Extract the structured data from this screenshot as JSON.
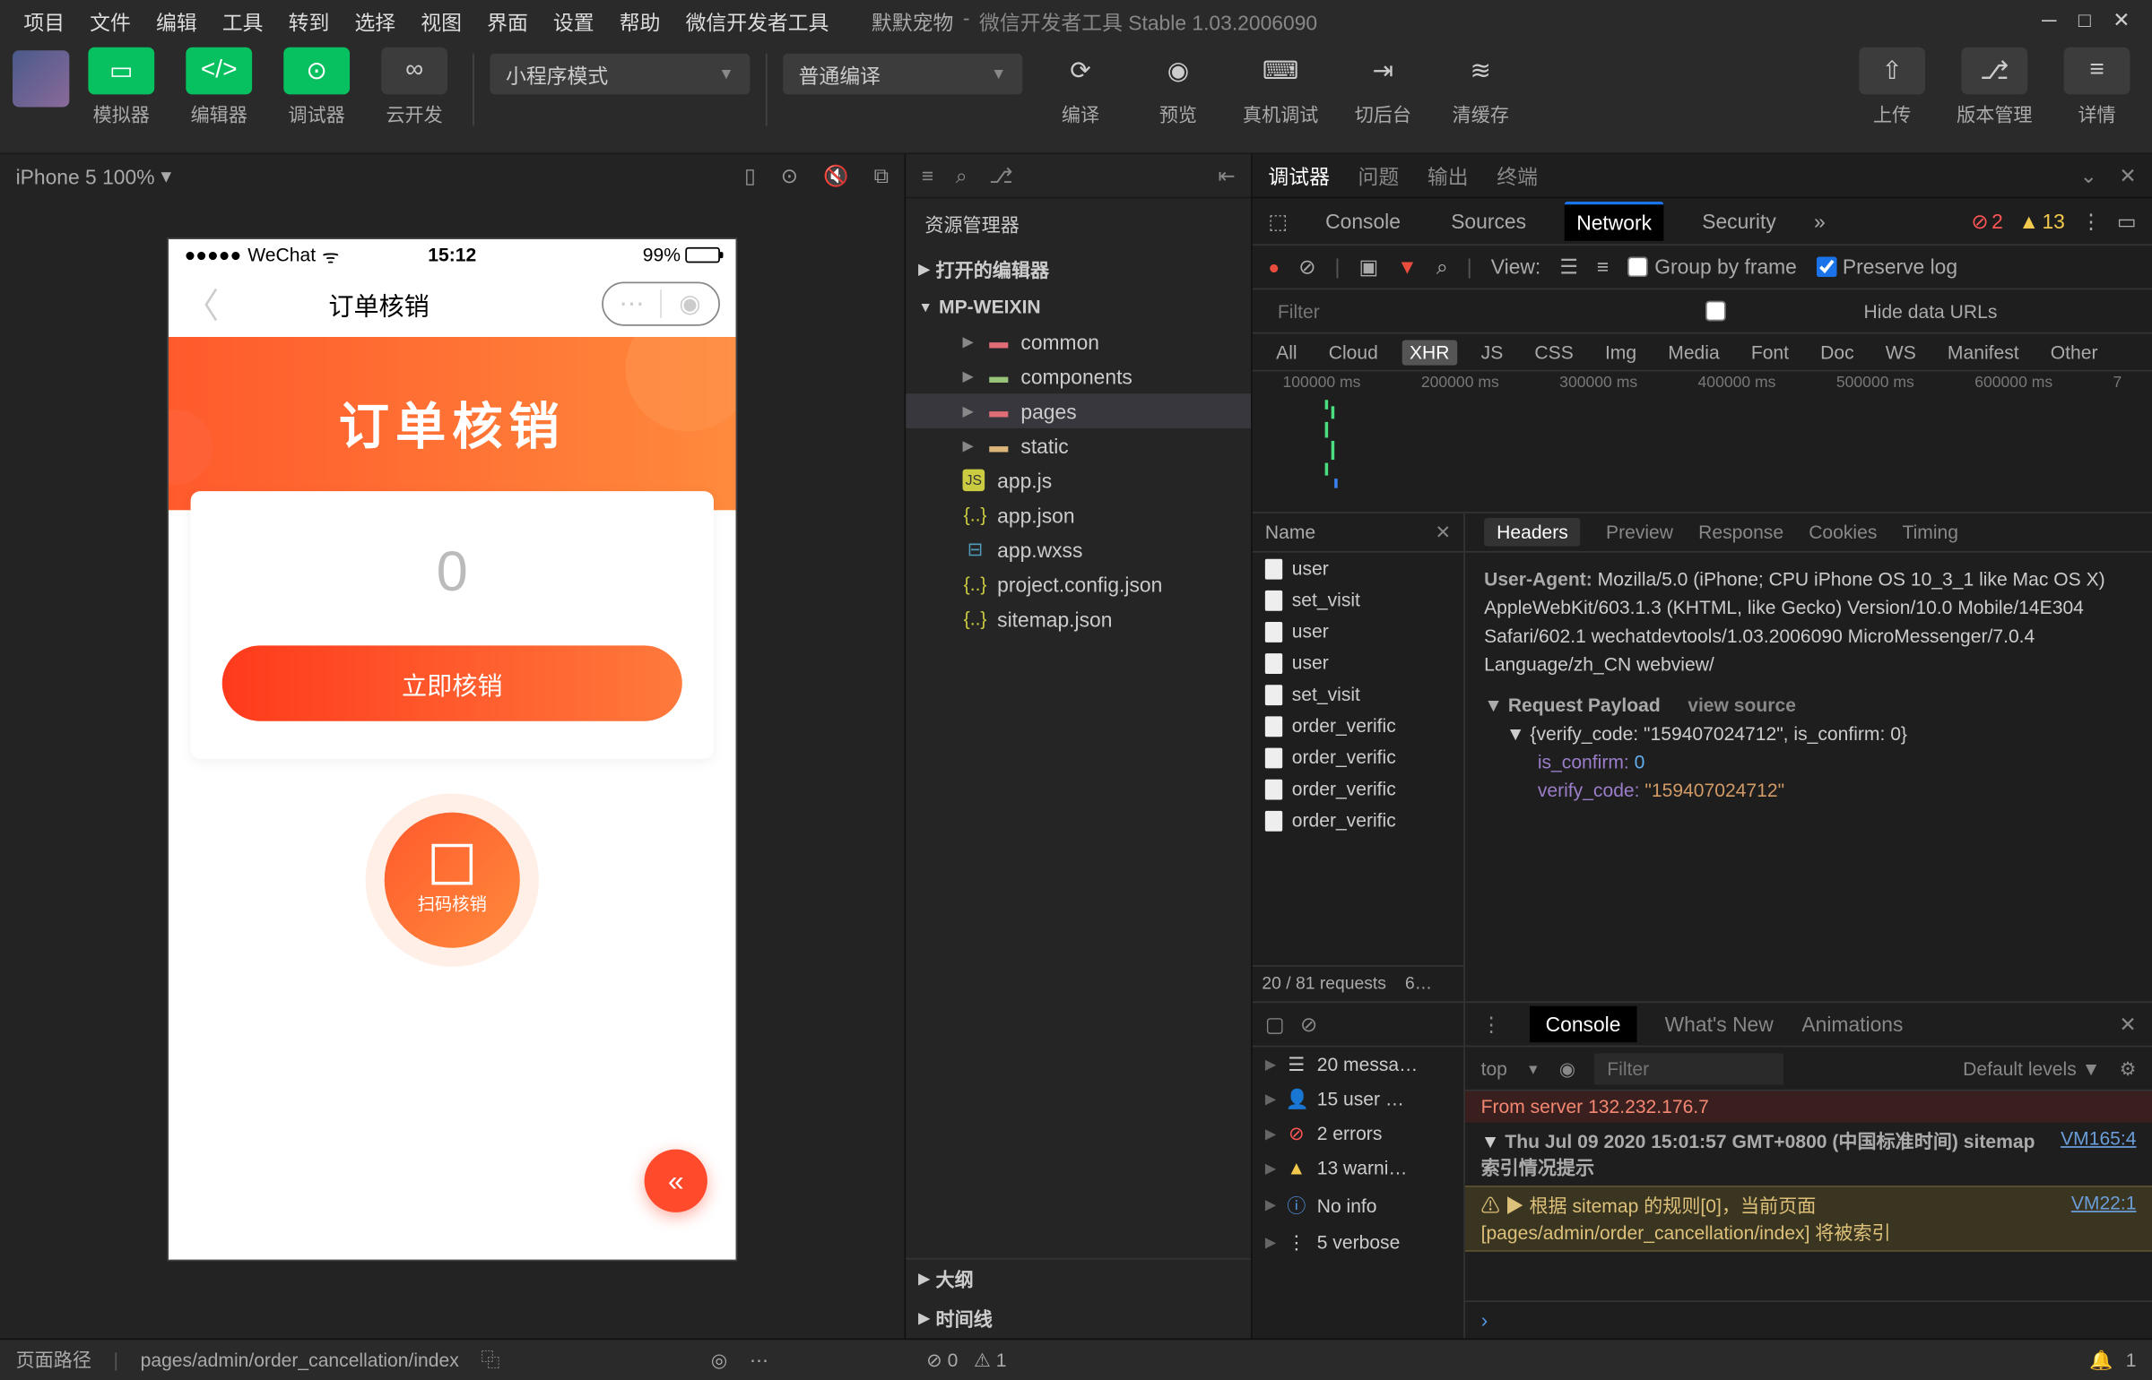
{
  "menus": [
    "项目",
    "文件",
    "编辑",
    "工具",
    "转到",
    "选择",
    "视图",
    "界面",
    "设置",
    "帮助",
    "微信开发者工具"
  ],
  "window": {
    "project": "默默宠物",
    "app": "微信开发者工具 Stable 1.03.2006090"
  },
  "toolbar": {
    "sim": "模拟器",
    "editor": "编辑器",
    "debugger": "调试器",
    "cloud": "云开发",
    "mode": "小程序模式",
    "compileMode": "普通编译",
    "compile": "编译",
    "preview": "预览",
    "remote": "真机调试",
    "bg": "切后台",
    "clear": "清缓存",
    "upload": "上传",
    "version": "版本管理",
    "detail": "详情"
  },
  "sim": {
    "device": "iPhone 5 100%",
    "arrow": "▾"
  },
  "phone": {
    "carrier": "WeChat",
    "time": "15:12",
    "battery": "99%",
    "navTitle": "订单核销",
    "bannerTitle": "订单核销",
    "inputValue": "0",
    "verifyBtn": "立即核销",
    "scanLabel": "扫码核销"
  },
  "explorer": {
    "title": "资源管理器",
    "openEditors": "打开的编辑器",
    "root": "MP-WEIXIN",
    "items": [
      {
        "t": "folder",
        "n": "common",
        "c": "red"
      },
      {
        "t": "folder",
        "n": "components",
        "c": "green"
      },
      {
        "t": "folder",
        "n": "pages",
        "c": "red",
        "sel": true
      },
      {
        "t": "folder",
        "n": "static",
        "c": ""
      },
      {
        "t": "js",
        "n": "app.js"
      },
      {
        "t": "json",
        "n": "app.json"
      },
      {
        "t": "wxss",
        "n": "app.wxss"
      },
      {
        "t": "json",
        "n": "project.config.json"
      },
      {
        "t": "json",
        "n": "sitemap.json"
      }
    ],
    "outline": "大纲",
    "timeline": "时间线"
  },
  "dbgTabs": {
    "debugger": "调试器",
    "problems": "问题",
    "output": "输出",
    "terminal": "终端"
  },
  "devtools": {
    "panels": [
      "Console",
      "Sources",
      "Network",
      "Security"
    ],
    "errCount": "2",
    "warnCount": "13",
    "view": "View:",
    "groupByFrame": "Group by frame",
    "preserveLog": "Preserve log",
    "filterPh": "Filter",
    "hideData": "Hide data URLs",
    "types": [
      "All",
      "Cloud",
      "XHR",
      "JS",
      "CSS",
      "Img",
      "Media",
      "Font",
      "Doc",
      "WS",
      "Manifest",
      "Other"
    ],
    "timelineTicks": [
      "100000 ms",
      "200000 ms",
      "300000 ms",
      "400000 ms",
      "500000 ms",
      "600000 ms",
      "7"
    ],
    "nameCol": "Name",
    "requests": [
      "user",
      "set_visit",
      "user",
      "user",
      "set_visit",
      "order_verific",
      "order_verific",
      "order_verific",
      "order_verific"
    ],
    "reqSummary": "20 / 81 requests",
    "reqSize": "6…",
    "detailTabs": [
      "Headers",
      "Preview",
      "Response",
      "Cookies",
      "Timing"
    ],
    "headers": {
      "uaLabel": "User-Agent:",
      "ua": "Mozilla/5.0 (iPhone; CPU iPhone OS 10_3_1 like Mac OS X) AppleWebKit/603.1.3 (KHTML, like Gecko) Version/10.0 Mobile/14E304 Safari/602.1 wechatdevtools/1.03.2006090 MicroMessenger/7.0.4 Language/zh_CN webview/",
      "payloadTitle": "Request Payload",
      "viewSource": "view source",
      "raw": "{verify_code: \"159407024712\", is_confirm: 0}",
      "p1k": "is_confirm:",
      "p1v": "0",
      "p2k": "verify_code:",
      "p2v": "\"159407024712\""
    }
  },
  "consoleDrawer": {
    "leftTabs": {
      "console": "Console"
    },
    "rows": [
      {
        "icon": "msg",
        "t": "20 messa…"
      },
      {
        "icon": "user",
        "t": "15 user …"
      },
      {
        "icon": "err",
        "t": "2 errors"
      },
      {
        "icon": "warn",
        "t": "13 warni…"
      },
      {
        "icon": "info",
        "t": "No info"
      },
      {
        "icon": "verb",
        "t": "5 verbose"
      }
    ],
    "rightTabs": [
      "Console",
      "What's New",
      "Animations"
    ],
    "top": "top",
    "levels": "Default levels",
    "filterPh": "Filter",
    "msgs": [
      {
        "type": "err",
        "body": "From server 132.232.176.7",
        "src": ""
      },
      {
        "type": "log",
        "body": "Thu Jul 09 2020 15:01:57 GMT+0800 (中国标准时间) sitemap 索引情况提示",
        "src": "VM165:4"
      },
      {
        "type": "warn",
        "body": "根据 sitemap 的规则[0]，当前页面 [pages/admin/order_cancellation/index] 将被索引",
        "src": "VM22:1"
      }
    ]
  },
  "status": {
    "pathLabel": "页面路径",
    "path": "pages/admin/order_cancellation/index",
    "mid_err": "0",
    "mid_warn": "1",
    "bell": "1"
  }
}
